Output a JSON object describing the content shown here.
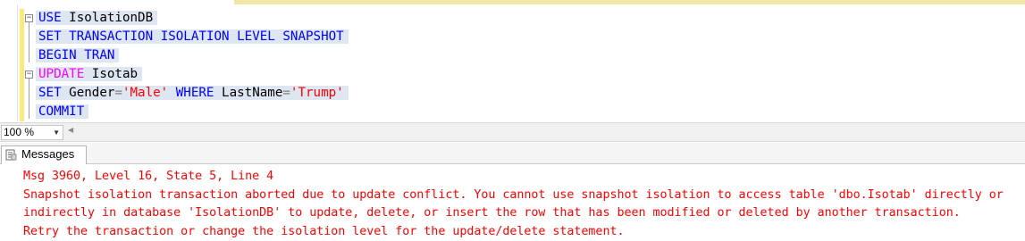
{
  "editor": {
    "lines": [
      [
        {
          "t": "USE",
          "c": "kw"
        },
        {
          "t": " IsolationDB",
          "c": "id"
        }
      ],
      [
        {
          "t": "SET",
          "c": "kw"
        },
        {
          "t": " ",
          "c": "id"
        },
        {
          "t": "TRANSACTION",
          "c": "kw"
        },
        {
          "t": " ",
          "c": "id"
        },
        {
          "t": "ISOLATION",
          "c": "kw"
        },
        {
          "t": " ",
          "c": "id"
        },
        {
          "t": "LEVEL",
          "c": "kw"
        },
        {
          "t": " ",
          "c": "id"
        },
        {
          "t": "SNAPSHOT",
          "c": "kw"
        }
      ],
      [
        {
          "t": "BEGIN",
          "c": "kw"
        },
        {
          "t": " ",
          "c": "id"
        },
        {
          "t": "TRAN",
          "c": "kw"
        }
      ],
      [
        {
          "t": "UPDATE",
          "c": "kw2"
        },
        {
          "t": " Isotab",
          "c": "id"
        }
      ],
      [
        {
          "t": "SET",
          "c": "kw"
        },
        {
          "t": " Gender",
          "c": "id"
        },
        {
          "t": "=",
          "c": "op"
        },
        {
          "t": "'Male'",
          "c": "str"
        },
        {
          "t": " ",
          "c": "id"
        },
        {
          "t": "WHERE",
          "c": "kw"
        },
        {
          "t": " LastName",
          "c": "id"
        },
        {
          "t": "=",
          "c": "op"
        },
        {
          "t": "'Trump'",
          "c": "str"
        }
      ],
      [
        {
          "t": "COMMIT",
          "c": "kw"
        }
      ]
    ]
  },
  "statusbar": {
    "zoom_value": "100 %"
  },
  "results": {
    "tab_label": "Messages",
    "message_lines": [
      "Msg 3960, Level 16, State 5, Line 4",
      "Snapshot isolation transaction aborted due to update conflict. You cannot use snapshot isolation to access table 'dbo.Isotab' directly or",
      "indirectly in database 'IsolationDB' to update, delete, or insert the row that has been modified or deleted by another transaction.",
      "Retry the transaction or change the isolation level for the update/delete statement."
    ]
  },
  "colors": {
    "keyword": "#0000ff",
    "dml_keyword": "#ff00ff",
    "string": "#ff0000",
    "error_text": "#ff0000",
    "selection": "#dde6f1"
  }
}
